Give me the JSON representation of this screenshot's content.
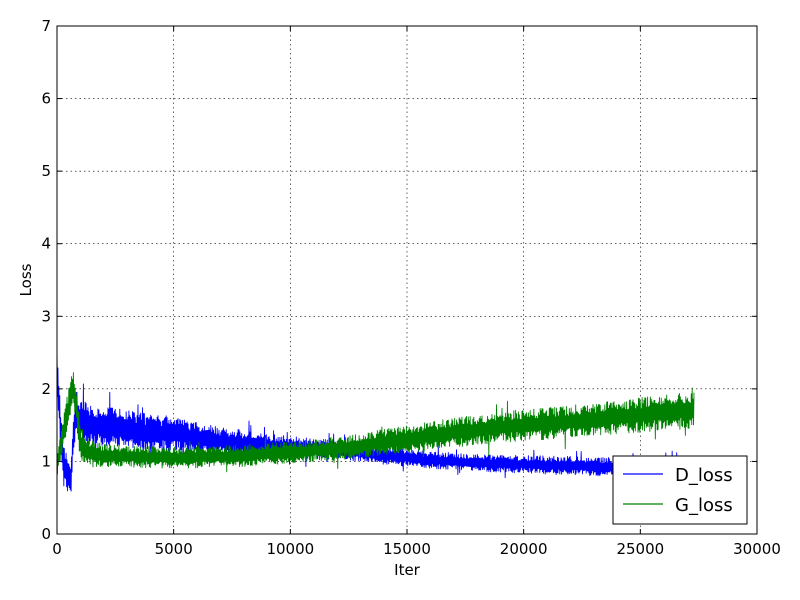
{
  "chart_data": {
    "type": "line",
    "title": "",
    "xlabel": "Iter",
    "ylabel": "Loss",
    "xlim": [
      0,
      30000
    ],
    "ylim": [
      0,
      7
    ],
    "xticks": [
      0,
      5000,
      10000,
      15000,
      20000,
      25000,
      30000
    ],
    "yticks": [
      0,
      1,
      2,
      3,
      4,
      5,
      6,
      7
    ],
    "grid": true,
    "legend": {
      "placement": "bottom-right"
    },
    "series": [
      {
        "name": "D_loss",
        "color": "#0000ff",
        "x": [
          0,
          200,
          400,
          600,
          700,
          800,
          1000,
          1500,
          2000,
          3000,
          4000,
          5000,
          6000,
          7000,
          8000,
          9000,
          10000,
          11000,
          12000,
          13000,
          14000,
          15000,
          16000,
          17000,
          18000,
          19000,
          20000,
          21000,
          22000,
          23000,
          24000,
          25000,
          26000,
          27000,
          27300
        ],
        "center": [
          2.2,
          1.2,
          0.85,
          0.75,
          1.3,
          1.7,
          1.55,
          1.5,
          1.5,
          1.45,
          1.4,
          1.38,
          1.32,
          1.28,
          1.25,
          1.22,
          1.2,
          1.18,
          1.16,
          1.12,
          1.08,
          1.05,
          1.02,
          1.0,
          0.98,
          0.97,
          0.96,
          0.95,
          0.94,
          0.93,
          0.92,
          0.92,
          0.92,
          0.92,
          0.92
        ],
        "spread": [
          0.3,
          0.3,
          0.25,
          0.22,
          0.25,
          0.35,
          0.3,
          0.28,
          0.28,
          0.26,
          0.25,
          0.24,
          0.22,
          0.2,
          0.18,
          0.16,
          0.15,
          0.14,
          0.13,
          0.12,
          0.12,
          0.12,
          0.12,
          0.12,
          0.12,
          0.12,
          0.12,
          0.13,
          0.13,
          0.13,
          0.13,
          0.14,
          0.14,
          0.14,
          0.14
        ]
      },
      {
        "name": "G_loss",
        "color": "#008000",
        "x": [
          0,
          200,
          400,
          600,
          700,
          800,
          1000,
          1500,
          2000,
          3000,
          4000,
          5000,
          6000,
          7000,
          8000,
          9000,
          10000,
          11000,
          12000,
          13000,
          14000,
          15000,
          16000,
          17000,
          18000,
          19000,
          20000,
          21000,
          22000,
          23000,
          24000,
          25000,
          26000,
          27000,
          27300
        ],
        "center": [
          0.9,
          1.3,
          1.6,
          1.9,
          2.0,
          1.85,
          1.25,
          1.1,
          1.08,
          1.07,
          1.06,
          1.05,
          1.06,
          1.07,
          1.08,
          1.1,
          1.12,
          1.15,
          1.18,
          1.22,
          1.27,
          1.3,
          1.35,
          1.4,
          1.43,
          1.47,
          1.5,
          1.52,
          1.55,
          1.58,
          1.61,
          1.64,
          1.67,
          1.7,
          1.72
        ],
        "spread": [
          0.15,
          0.2,
          0.25,
          0.25,
          0.25,
          0.3,
          0.25,
          0.18,
          0.16,
          0.15,
          0.15,
          0.15,
          0.15,
          0.15,
          0.15,
          0.15,
          0.15,
          0.15,
          0.16,
          0.17,
          0.18,
          0.19,
          0.2,
          0.2,
          0.21,
          0.21,
          0.22,
          0.22,
          0.22,
          0.23,
          0.23,
          0.24,
          0.24,
          0.25,
          0.25
        ]
      }
    ]
  }
}
